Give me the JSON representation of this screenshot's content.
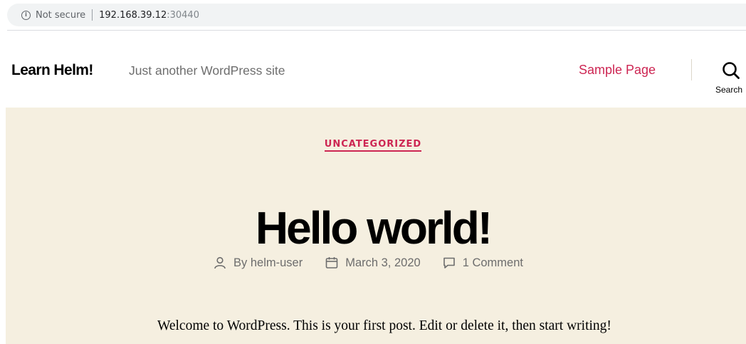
{
  "browser": {
    "security_label": "Not secure",
    "url_host": "192.168.39.12",
    "url_port": ":30440"
  },
  "header": {
    "site_title": "Learn Helm!",
    "site_description": "Just another WordPress site",
    "nav_items": [
      {
        "label": "Sample Page"
      }
    ],
    "search_label": "Search"
  },
  "post": {
    "category": "UNCATEGORIZED",
    "title": "Hello world!",
    "author": "By helm-user",
    "date": "March 3, 2020",
    "comments": "1 Comment",
    "content": "Welcome to WordPress. This is your first post. Edit or delete it, then start writing!"
  },
  "colors": {
    "accent": "#cd2653",
    "entry_background": "#f5efe0",
    "secondary_text": "#6d6d6d"
  }
}
